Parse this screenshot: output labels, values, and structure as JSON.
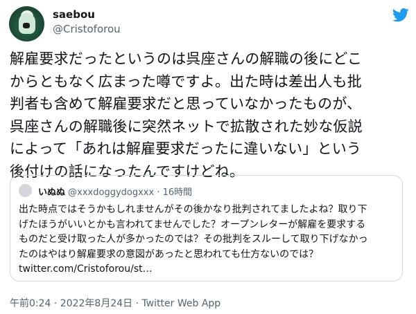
{
  "author": {
    "display_name": "saebou",
    "handle": "@Cristoforou",
    "avatar_icon": "green-character-avatar"
  },
  "brand": {
    "icon": "twitter-bird-icon",
    "color": "#1d9bf0"
  },
  "tweet": {
    "lines": [
      "解雇要求だったというのは呉座さんの解職の後にどこ",
      "からともなく広まった噂ですよ。出た時は差出人も批",
      "判者も含めて解雇要求だと思っていなかったものが、",
      "呉座さんの解職後に突然ネットで拡散された妙な仮説",
      "によって「あれは解雇要求だったに違いない」という",
      "後付けの話になったんですけどね。"
    ]
  },
  "quote": {
    "display_name": "いぬぬ",
    "handle": "@xxxdoggydogxxx",
    "separator": "·",
    "time": "16時間",
    "lines": [
      "出た時点ではそうかもしれませんがその後かなり批判されてましたよね？取り下",
      "げたほうがいいとかも言われてませんでした？オープンレターが解雇を要求する",
      "ものだと受け取った人が多かったのでは？その批判をスルーして取り下げなかっ",
      "たのはやはり解雇要求の意図があったと思われても仕方ないのでは？",
      "twitter.com/Cristoforou/st…"
    ]
  },
  "meta": {
    "text": "午前0:24 · 2022年8月24日 · Twitter Web App"
  }
}
